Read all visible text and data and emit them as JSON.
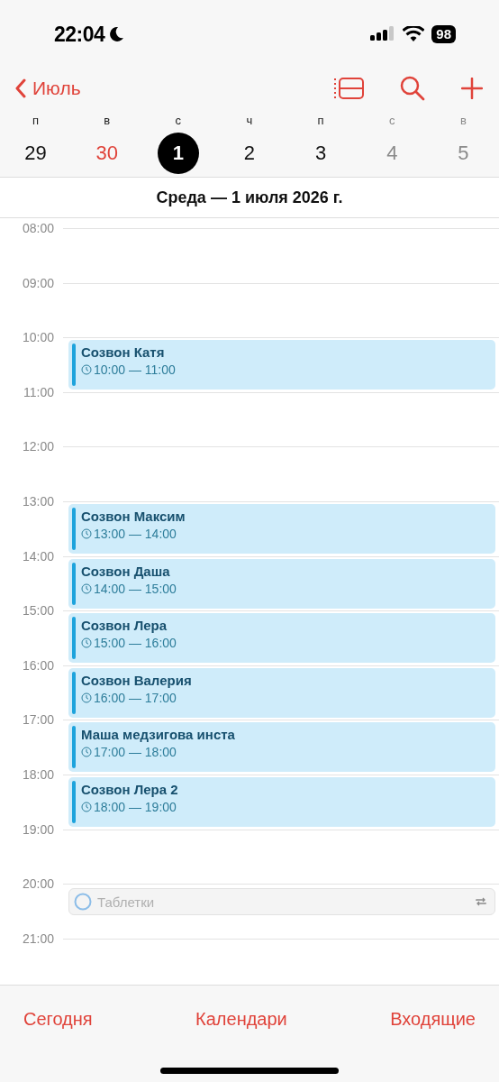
{
  "status_bar": {
    "time": "22:04",
    "battery": "98"
  },
  "nav": {
    "back": "Июль"
  },
  "week": [
    {
      "weekday": "п",
      "day": "29",
      "selected": false,
      "today": false,
      "weekend": false
    },
    {
      "weekday": "в",
      "day": "30",
      "selected": false,
      "today": true,
      "weekend": false
    },
    {
      "weekday": "с",
      "day": "1",
      "selected": true,
      "today": false,
      "weekend": false
    },
    {
      "weekday": "ч",
      "day": "2",
      "selected": false,
      "today": false,
      "weekend": false
    },
    {
      "weekday": "п",
      "day": "3",
      "selected": false,
      "today": false,
      "weekend": false
    },
    {
      "weekday": "с",
      "day": "4",
      "selected": false,
      "today": false,
      "weekend": true
    },
    {
      "weekday": "в",
      "day": "5",
      "selected": false,
      "today": false,
      "weekend": true
    }
  ],
  "date_title": "Среда — 1 июля 2026 г.",
  "hours": [
    {
      "label": "08:00"
    },
    {
      "label": "09:00"
    },
    {
      "label": "10:00",
      "events": [
        {
          "kind": "event",
          "title": "Созвон Катя",
          "time": "10:00 — 11:00"
        }
      ]
    },
    {
      "label": "11:00"
    },
    {
      "label": "12:00"
    },
    {
      "label": "13:00",
      "events": [
        {
          "kind": "event",
          "title": "Созвон Максим",
          "time": "13:00 — 14:00"
        }
      ]
    },
    {
      "label": "14:00",
      "events": [
        {
          "kind": "event",
          "title": "Созвон Даша",
          "time": "14:00 — 15:00"
        }
      ]
    },
    {
      "label": "15:00",
      "events": [
        {
          "kind": "event",
          "title": "Созвон Лера",
          "time": "15:00 — 16:00"
        }
      ]
    },
    {
      "label": "16:00",
      "events": [
        {
          "kind": "event",
          "title": "Созвон Валерия",
          "time": "16:00 — 17:00"
        }
      ]
    },
    {
      "label": "17:00",
      "events": [
        {
          "kind": "event",
          "title": "Маша медзигова инста",
          "time": "17:00 — 18:00"
        }
      ]
    },
    {
      "label": "18:00",
      "events": [
        {
          "kind": "event",
          "title": "Созвон Лера 2",
          "time": "18:00 — 19:00"
        }
      ]
    },
    {
      "label": "19:00"
    },
    {
      "label": "20:00",
      "events": [
        {
          "kind": "reminder",
          "title": "Таблетки"
        }
      ]
    },
    {
      "label": "21:00"
    }
  ],
  "toolbar": [
    "Сегодня",
    "Календари",
    "Входящие"
  ]
}
